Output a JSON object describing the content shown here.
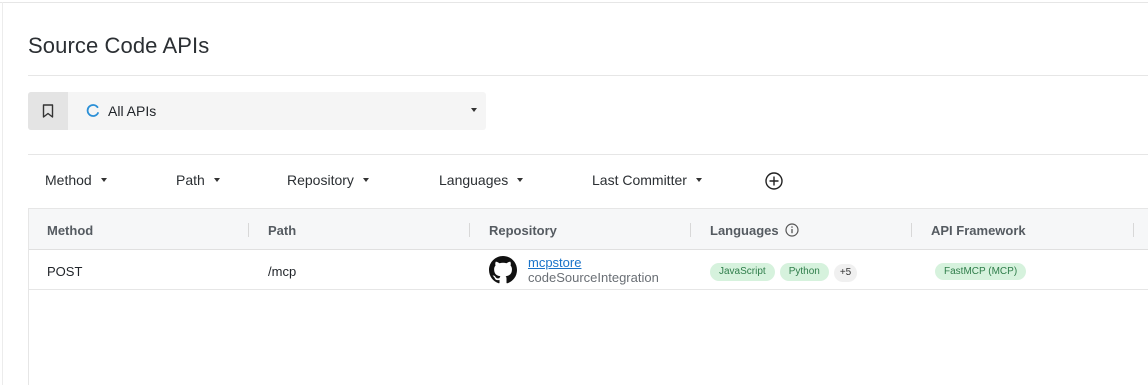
{
  "page": {
    "title": "Source Code APIs"
  },
  "view_selector": {
    "label": "All APIs"
  },
  "filters": [
    {
      "label": "Method"
    },
    {
      "label": "Path"
    },
    {
      "label": "Repository"
    },
    {
      "label": "Languages"
    },
    {
      "label": "Last Committer"
    }
  ],
  "table": {
    "columns": [
      "Method",
      "Path",
      "Repository",
      "Languages",
      "API Framework"
    ],
    "rows": [
      {
        "method": "POST",
        "path": "/mcp",
        "repository": {
          "name": "mcpstore",
          "source": "codeSourceIntegration",
          "icon": "github-icon"
        },
        "languages": [
          "JavaScript",
          "Python"
        ],
        "languages_more": "+5",
        "framework": "FastMCP (MCP)"
      }
    ]
  },
  "colors": {
    "tag_bg": "#d6f2dd",
    "tag_text": "#2f7d4a",
    "link": "#1a73c9"
  }
}
